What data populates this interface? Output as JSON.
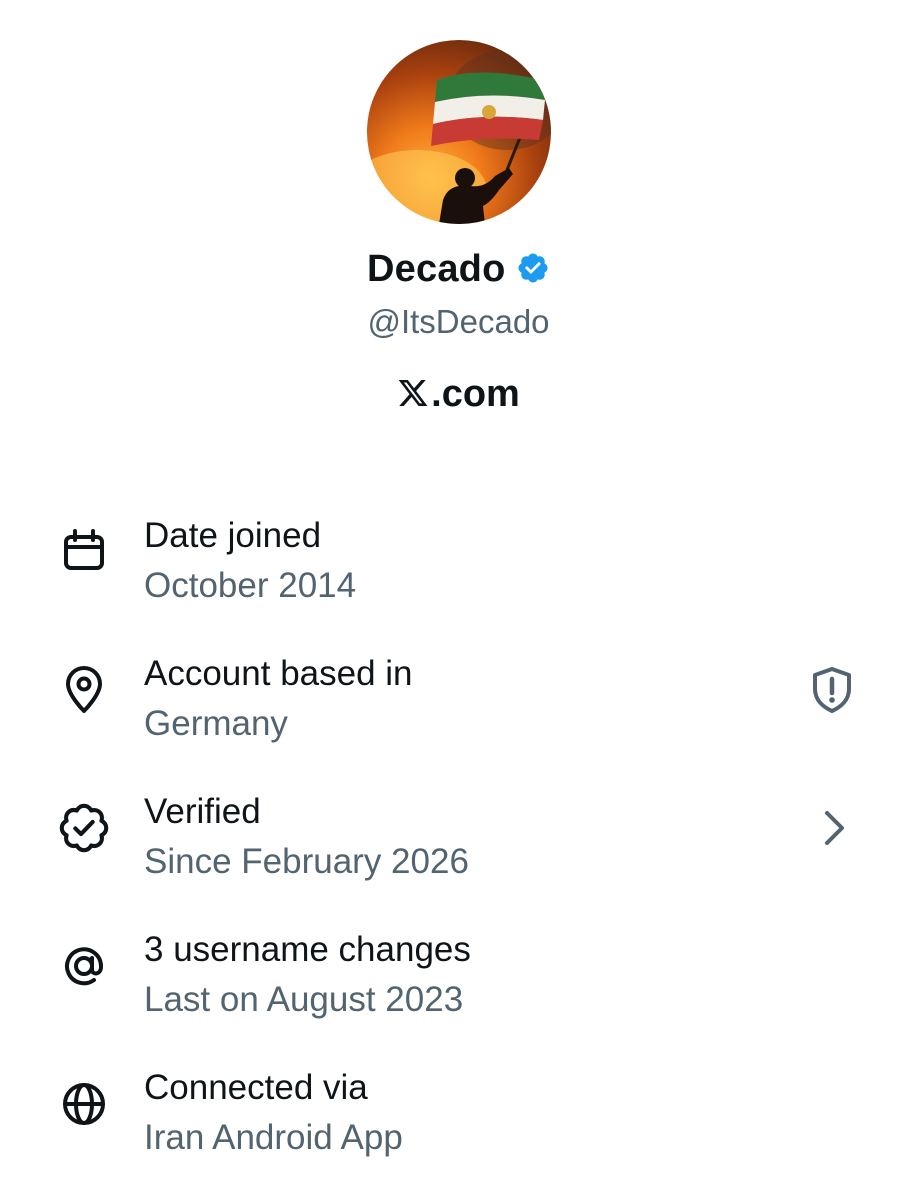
{
  "profile": {
    "display_name": "Decado",
    "handle": "@ItsDecado",
    "site": ".com",
    "verified_color": "#1d9bf0"
  },
  "info_rows": [
    {
      "icon": "calendar-icon",
      "title": "Date joined",
      "subtitle": "October 2014"
    },
    {
      "icon": "location-pin-icon",
      "title": "Account based in",
      "subtitle": "Germany",
      "action_icon": "shield-alert-icon"
    },
    {
      "icon": "verified-badge-icon",
      "title": "Verified",
      "subtitle": "Since February 2026",
      "action_icon": "chevron-right-icon"
    },
    {
      "icon": "at-sign-icon",
      "title": "3 username changes",
      "subtitle": "Last on August 2023"
    },
    {
      "icon": "globe-icon",
      "title": "Connected via",
      "subtitle": "Iran Android App"
    }
  ],
  "colors": {
    "text_primary": "#0f1419",
    "text_secondary": "#536471",
    "background": "#ffffff"
  }
}
